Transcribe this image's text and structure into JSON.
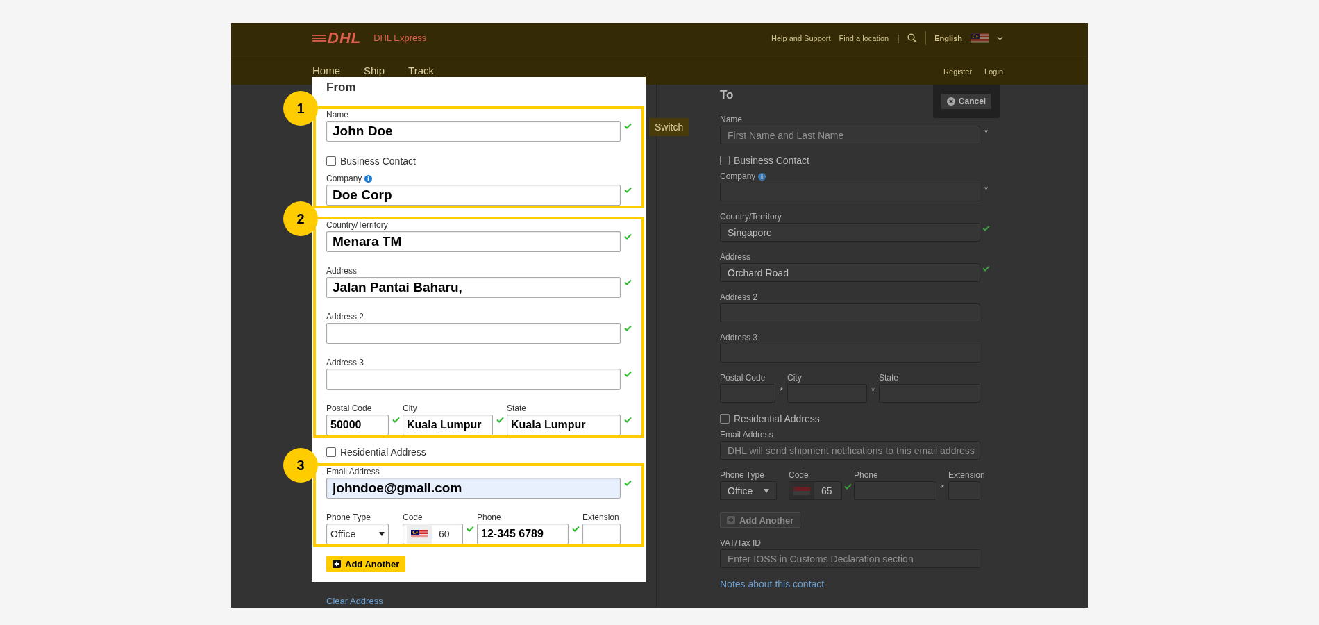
{
  "header": {
    "logo": "DHL",
    "brand": "DHL Express",
    "links": [
      {
        "label": "Help and Support"
      },
      {
        "label": "Find a location"
      }
    ],
    "separator": "|",
    "language": "English"
  },
  "nav": {
    "items": [
      {
        "label": "Home"
      },
      {
        "label": "Ship"
      },
      {
        "label": "Track"
      }
    ],
    "account": [
      {
        "label": "Register"
      },
      {
        "label": "Login"
      }
    ]
  },
  "switch_button": "Switch",
  "clear_address": "Clear Address",
  "from": {
    "title": "From",
    "blocks": [
      {
        "kind": "section",
        "number": "1",
        "items": [
          {
            "kind": "field",
            "label": "Name",
            "value": "John Doe",
            "valid": true
          },
          {
            "kind": "checkbox",
            "label": "Business Contact",
            "checked": false
          },
          {
            "kind": "field",
            "label": "Company",
            "info": true,
            "value": "Doe Corp",
            "valid": true
          }
        ]
      },
      {
        "kind": "section",
        "number": "2",
        "items": [
          {
            "kind": "field",
            "label": "Country/Territory",
            "value": "Menara TM",
            "valid": true
          },
          {
            "kind": "field",
            "label": "Address",
            "value": "Jalan Pantai Baharu,",
            "valid": true
          },
          {
            "kind": "field",
            "label": "Address 2",
            "valid": true
          },
          {
            "kind": "field",
            "label": "Address 3",
            "valid": true
          },
          {
            "kind": "address_row",
            "fields": [
              {
                "kind": "text",
                "label": "Postal Code",
                "value": "50000",
                "valid": true
              },
              {
                "kind": "text",
                "label": "City",
                "value": "Kuala Lumpur",
                "valid": true
              },
              {
                "kind": "text",
                "label": "State",
                "value": "Kuala Lumpur",
                "valid": true
              }
            ]
          }
        ]
      },
      {
        "kind": "checkbox",
        "label": "Residential Address",
        "checked": false
      },
      {
        "kind": "section",
        "number": "3",
        "items": [
          {
            "kind": "field",
            "label": "Email Address",
            "value": "johndoe@gmail.com",
            "valid": true,
            "autofilled": true
          },
          {
            "kind": "phone_row",
            "fields": [
              {
                "kind": "select",
                "label": "Phone Type",
                "value": "Office",
                "valid": false
              },
              {
                "kind": "code",
                "label": "Code",
                "value": "60",
                "valid": true
              },
              {
                "kind": "text",
                "label": "Phone",
                "value": "12-345 6789",
                "valid": true
              },
              {
                "kind": "text",
                "label": "Extension",
                "valid": false
              }
            ]
          }
        ]
      },
      {
        "kind": "button",
        "label": "Add Another",
        "disabled": false
      }
    ]
  },
  "to": {
    "title": "To",
    "cancel": "Cancel",
    "items": [
      {
        "kind": "field",
        "label": "Name",
        "placeholder": "First Name and Last Name",
        "valid": false,
        "mark": "*"
      },
      {
        "kind": "checkbox",
        "label": "Business Contact",
        "checked": false
      },
      {
        "kind": "field",
        "label": "Company",
        "info": true,
        "valid": false,
        "mark": "*"
      },
      {
        "kind": "field",
        "label": "Country/Territory",
        "value": "Singapore",
        "valid": true
      },
      {
        "kind": "field",
        "label": "Address",
        "value": "Orchard Road",
        "valid": true
      },
      {
        "kind": "field",
        "label": "Address 2",
        "valid": false
      },
      {
        "kind": "field",
        "label": "Address 3",
        "valid": false
      },
      {
        "kind": "address_row",
        "fields": [
          {
            "kind": "text",
            "label": "Postal Code",
            "valid": false,
            "mark": "*"
          },
          {
            "kind": "text",
            "label": "City",
            "valid": false,
            "mark": "*"
          },
          {
            "kind": "text",
            "label": "State",
            "valid": false
          }
        ]
      },
      {
        "kind": "checkbox",
        "label": "Residential Address",
        "checked": false
      },
      {
        "kind": "field",
        "label": "Email Address",
        "placeholder": "DHL will send shipment notifications to this email address",
        "valid": false
      },
      {
        "kind": "phone_row",
        "fields": [
          {
            "kind": "select",
            "label": "Phone Type",
            "value": "Office",
            "valid": false
          },
          {
            "kind": "code",
            "label": "Code",
            "value": "65",
            "valid": true
          },
          {
            "kind": "text",
            "label": "Phone",
            "valid": false,
            "mark": "*"
          },
          {
            "kind": "text",
            "label": "Extension",
            "valid": false
          }
        ]
      },
      {
        "kind": "button",
        "label": "Add Another",
        "disabled": true
      },
      {
        "kind": "field",
        "label": "VAT/Tax ID",
        "placeholder": "Enter IOSS in Customs Declaration section",
        "valid": false
      },
      {
        "kind": "link",
        "label": "Notes about this contact"
      }
    ]
  }
}
